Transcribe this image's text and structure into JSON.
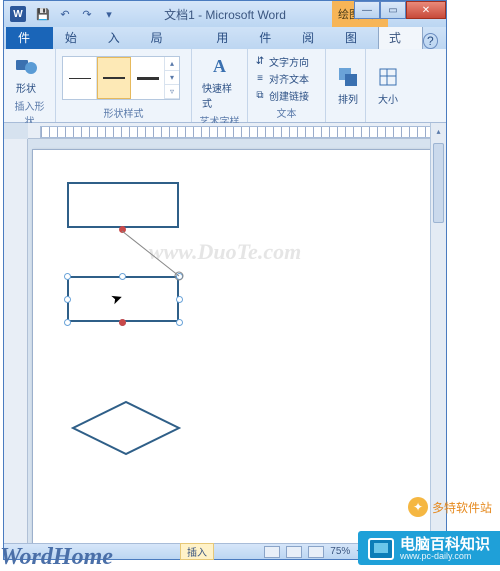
{
  "titlebar": {
    "app_icon_text": "W",
    "doc_title": "文档1 - Microsoft Word",
    "context_tab": "绘图工具"
  },
  "tabs": {
    "file": "文件",
    "items": [
      "开始",
      "插入",
      "页面布局",
      "引用",
      "邮件",
      "审阅",
      "视图",
      "格式"
    ],
    "active_index": 7
  },
  "ribbon": {
    "g1": {
      "label": "插入形状",
      "btn": "形状"
    },
    "g2": {
      "label": "形状样式"
    },
    "g3": {
      "label": "艺术字样式",
      "btn": "快速样式"
    },
    "g4": {
      "label": "文本",
      "items": [
        "文字方向",
        "对齐文本",
        "创建链接"
      ]
    },
    "g5": {
      "label": "",
      "btn": "排列"
    },
    "g6": {
      "label": "",
      "btn": "大小"
    }
  },
  "status": {
    "left": "插入",
    "zoom": "75%"
  },
  "watermarks": {
    "center": "www.DuoTe.com",
    "bottom_left": "WordHome"
  },
  "brands": {
    "duote": "多特软件站",
    "pcdaily_zh": "电脑百科知识",
    "pcdaily_en": "www.pc-daily.com"
  }
}
